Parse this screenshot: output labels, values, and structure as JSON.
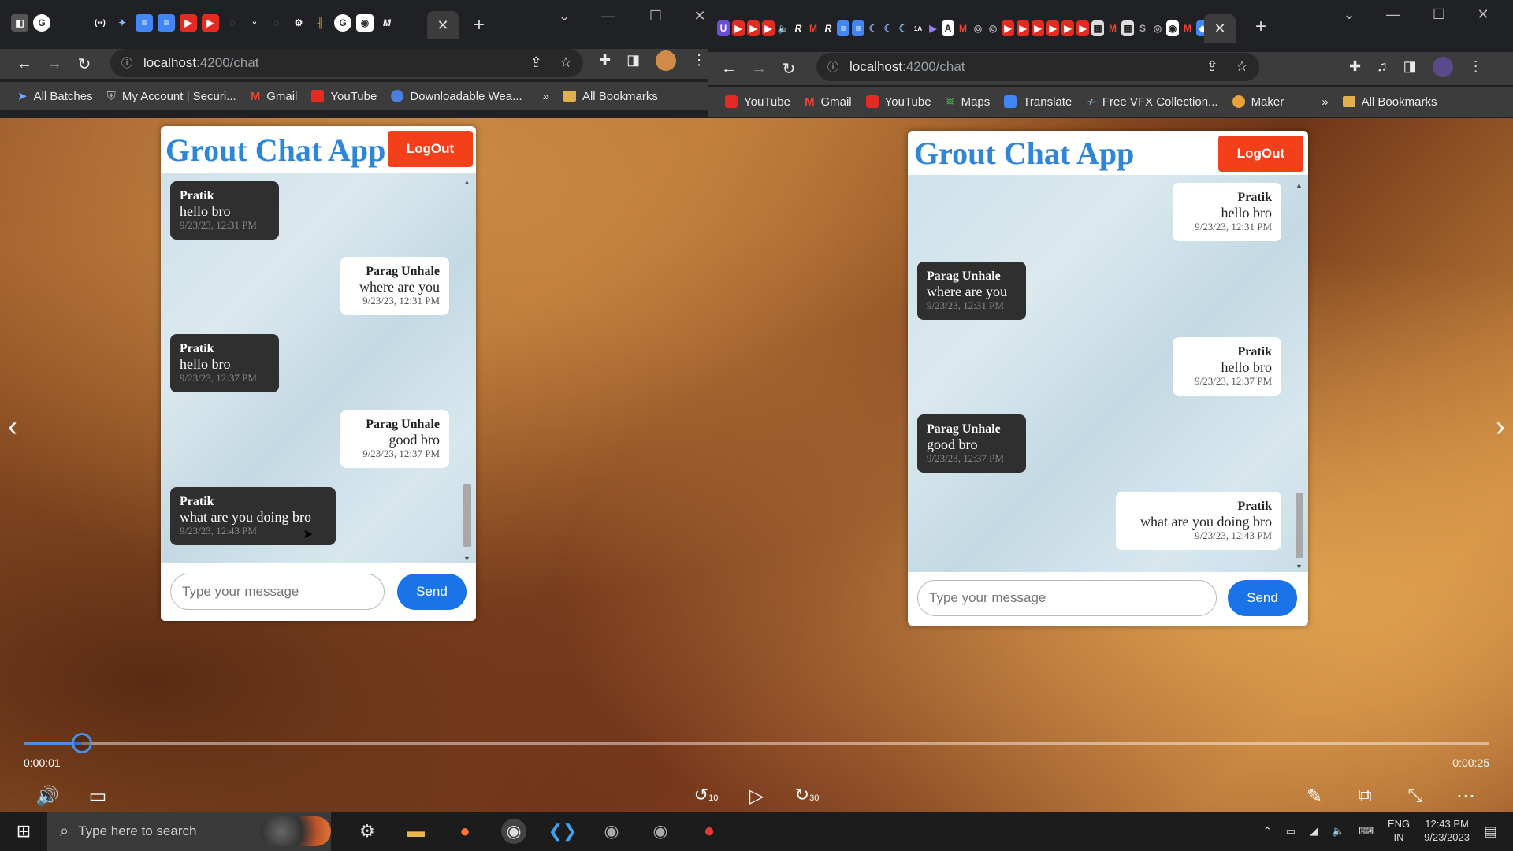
{
  "left_browser": {
    "url_host": "localhost",
    "url_path": ":4200/chat",
    "bookmarks": [
      "All Batches",
      "My Account | Securi...",
      "Gmail",
      "YouTube",
      "Downloadable Wea..."
    ],
    "overflow": "»",
    "all_bookmarks": "All Bookmarks"
  },
  "right_browser": {
    "url_host": "localhost",
    "url_path": ":4200/chat",
    "bookmarks": [
      "YouTube",
      "Gmail",
      "YouTube",
      "Maps",
      "Translate",
      "Free VFX Collection...",
      "Maker"
    ],
    "overflow": "»",
    "all_bookmarks": "All Bookmarks"
  },
  "chat": {
    "title": "Grout Chat App",
    "logout_label": "LogOut",
    "input_placeholder": "Type your message",
    "send_label": "Send"
  },
  "left_messages": [
    {
      "sender": "Pratik",
      "text": "hello bro",
      "time": "9/23/23, 12:31 PM",
      "side": "dark"
    },
    {
      "sender": "Parag Unhale",
      "text": "where are you",
      "time": "9/23/23, 12:31 PM",
      "side": "light"
    },
    {
      "sender": "Pratik",
      "text": "hello bro",
      "time": "9/23/23, 12:37 PM",
      "side": "dark"
    },
    {
      "sender": "Parag Unhale",
      "text": "good bro",
      "time": "9/23/23, 12:37 PM",
      "side": "light"
    },
    {
      "sender": "Pratik",
      "text": "what are you doing bro",
      "time": "9/23/23, 12:43 PM",
      "side": "dark"
    }
  ],
  "right_messages": [
    {
      "sender": "Pratik",
      "text": "hello bro",
      "time": "9/23/23, 12:31 PM",
      "side": "light"
    },
    {
      "sender": "Parag Unhale",
      "text": "where are you",
      "time": "9/23/23, 12:31 PM",
      "side": "dark"
    },
    {
      "sender": "Pratik",
      "text": "hello bro",
      "time": "9/23/23, 12:37 PM",
      "side": "light"
    },
    {
      "sender": "Parag Unhale",
      "text": "good bro",
      "time": "9/23/23, 12:37 PM",
      "side": "dark"
    },
    {
      "sender": "Pratik",
      "text": "what are you doing bro",
      "time": "9/23/23, 12:43 PM",
      "side": "light"
    }
  ],
  "player": {
    "current_time": "0:00:01",
    "total_time": "0:00:25",
    "progress_fraction": 0.04,
    "rewind_label": "10",
    "forward_label": "30"
  },
  "taskbar": {
    "search_placeholder": "Type here to search",
    "lang_top": "ENG",
    "lang_bottom": "IN",
    "time": "12:43 PM",
    "date": "9/23/2023"
  },
  "colors": {
    "title_blue": "#2f86d8",
    "logout_red": "#f33f1a",
    "send_blue": "#1a73e8",
    "seek_blue": "#4d8de3"
  }
}
